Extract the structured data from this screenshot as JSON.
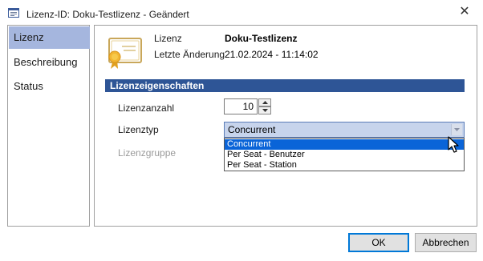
{
  "window": {
    "title": "Lizenz-ID: Doku-Testlizenz - Geändert",
    "close_glyph": "✕"
  },
  "sidebar": {
    "items": [
      {
        "label": "Lizenz",
        "active": true
      },
      {
        "label": "Beschreibung",
        "active": false
      },
      {
        "label": "Status",
        "active": false
      }
    ]
  },
  "header": {
    "license_label": "Lizenz",
    "license_value": "Doku-Testlizenz",
    "changed_label": "Letzte Änderung",
    "changed_value": "21.02.2024 - 11:14:02"
  },
  "section": {
    "title": "Lizenzeigenschaften"
  },
  "form": {
    "count_label": "Lizenzanzahl",
    "count_value": "10",
    "type_label": "Lizenztyp",
    "type_value": "Concurrent",
    "group_label": "Lizenzgruppe",
    "type_options": [
      {
        "label": "Concurrent",
        "selected": true
      },
      {
        "label": "Per Seat - Benutzer",
        "selected": false
      },
      {
        "label": "Per Seat - Station",
        "selected": false
      }
    ]
  },
  "buttons": {
    "ok_label": "OK",
    "cancel_label": "Abbrechen"
  },
  "colors": {
    "sidebar_active": "#a5b6de",
    "section_bar": "#2e5596",
    "combo_bg": "#c7d4ec",
    "dropdown_selected": "#0a64d8"
  }
}
